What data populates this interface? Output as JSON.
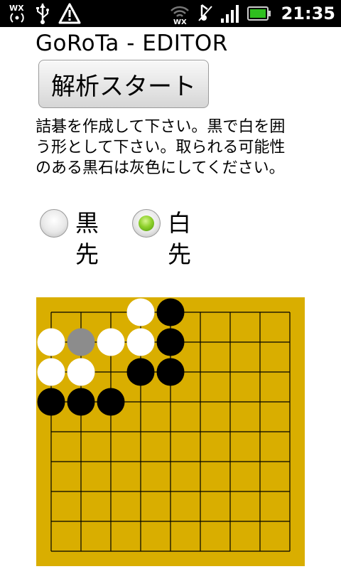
{
  "status_bar": {
    "time": "21:35",
    "icons": [
      "wx-broadcast-icon",
      "usb-icon",
      "warning-icon",
      "wifi-wx-icon",
      "vibrate-icon",
      "signal-icon",
      "battery-icon"
    ],
    "battery_color": "#2fbf1f"
  },
  "app": {
    "title": "GoRoTa - EDITOR",
    "start_button_label": "解析スタート",
    "instruction": "詰碁を作成して下さい。黒で白を囲う形として下さい。取られる可能性のある黒石は灰色にしてください。"
  },
  "turn_options": [
    {
      "label": "黒先",
      "checked": false
    },
    {
      "label": "白先",
      "checked": true
    }
  ],
  "board": {
    "size": 9,
    "background": "#d9ae00",
    "line_color": "#000000",
    "stones": [
      {
        "row": 0,
        "col": 3,
        "color": "white"
      },
      {
        "row": 0,
        "col": 4,
        "color": "black"
      },
      {
        "row": 1,
        "col": 0,
        "color": "white"
      },
      {
        "row": 1,
        "col": 1,
        "color": "gray"
      },
      {
        "row": 1,
        "col": 2,
        "color": "white"
      },
      {
        "row": 1,
        "col": 3,
        "color": "white"
      },
      {
        "row": 1,
        "col": 4,
        "color": "black"
      },
      {
        "row": 2,
        "col": 0,
        "color": "white"
      },
      {
        "row": 2,
        "col": 1,
        "color": "white"
      },
      {
        "row": 2,
        "col": 3,
        "color": "black"
      },
      {
        "row": 2,
        "col": 4,
        "color": "black"
      },
      {
        "row": 3,
        "col": 0,
        "color": "black"
      },
      {
        "row": 3,
        "col": 1,
        "color": "black"
      },
      {
        "row": 3,
        "col": 2,
        "color": "black"
      }
    ],
    "stone_colors": {
      "white": "#ffffff",
      "black": "#000000",
      "gray": "#8c8c8c"
    }
  }
}
